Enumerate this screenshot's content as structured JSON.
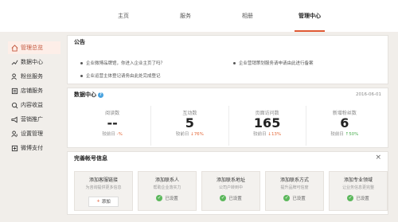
{
  "top_nav": {
    "tabs": [
      {
        "label": "主页"
      },
      {
        "label": "服务"
      },
      {
        "label": "相册"
      },
      {
        "label": "管理中心"
      }
    ]
  },
  "sidebar": {
    "items": [
      {
        "label": "管理总览",
        "icon": "home-icon"
      },
      {
        "label": "数据中心",
        "icon": "data-icon"
      },
      {
        "label": "粉丝服务",
        "icon": "fans-icon"
      },
      {
        "label": "店铺服务",
        "icon": "store-icon"
      },
      {
        "label": "内容收益",
        "icon": "content-icon"
      },
      {
        "label": "营销推广",
        "icon": "marketing-icon"
      },
      {
        "label": "设置管理",
        "icon": "settings-icon"
      },
      {
        "label": "微博支付",
        "icon": "payment-icon"
      }
    ]
  },
  "notice": {
    "title": "公告",
    "items": [
      {
        "text": "企业微博品牌馆，你进入企业主页了吗？"
      },
      {
        "text": "企业营销策划服务请申请由此进行备案"
      },
      {
        "text": "企业运营主体登记请务由此处完成登记"
      }
    ]
  },
  "data_center": {
    "title": "数据中心",
    "help_glyph": "?",
    "date": "2016-06-01",
    "metrics": [
      {
        "label": "阅读数",
        "value": "--",
        "compare_label": "较前日",
        "compare_value": "-%",
        "trend_glyph": ""
      },
      {
        "label": "互动数",
        "value": "5",
        "compare_label": "较前日",
        "compare_value": "76%",
        "trend_glyph": "↓"
      },
      {
        "label": "页面访问数",
        "value": "165",
        "compare_label": "较前日",
        "compare_value": "13%",
        "trend_glyph": "↓"
      },
      {
        "label": "新增粉丝数",
        "value": "6",
        "compare_label": "较前日",
        "compare_value": "50%",
        "trend_glyph": "↑"
      }
    ]
  },
  "complete_account": {
    "title": "完善帐号信息",
    "close_glyph": "×",
    "cards": [
      {
        "title": "添加客服链接",
        "desc": "为咨询提供更多信息",
        "action": "添加",
        "action_glyph": "+"
      },
      {
        "title": "添加联系人",
        "desc": "帮助企业落实力",
        "status": "已设置",
        "status_glyph": "✓"
      },
      {
        "title": "添加联系地址",
        "desc": "公司户转到中",
        "status": "已设置",
        "status_glyph": "✓"
      },
      {
        "title": "添加联系方式",
        "desc": "提升品牌可信度",
        "status": "已设置",
        "status_glyph": "✓"
      },
      {
        "title": "添加专业领域",
        "desc": "让业务信息更完整",
        "status": "已设置",
        "status_glyph": "✓"
      }
    ]
  },
  "colors": {
    "accent": "#e05a35",
    "background": "#f1eeea",
    "success": "#5cb85c",
    "help": "#4aa3df"
  }
}
